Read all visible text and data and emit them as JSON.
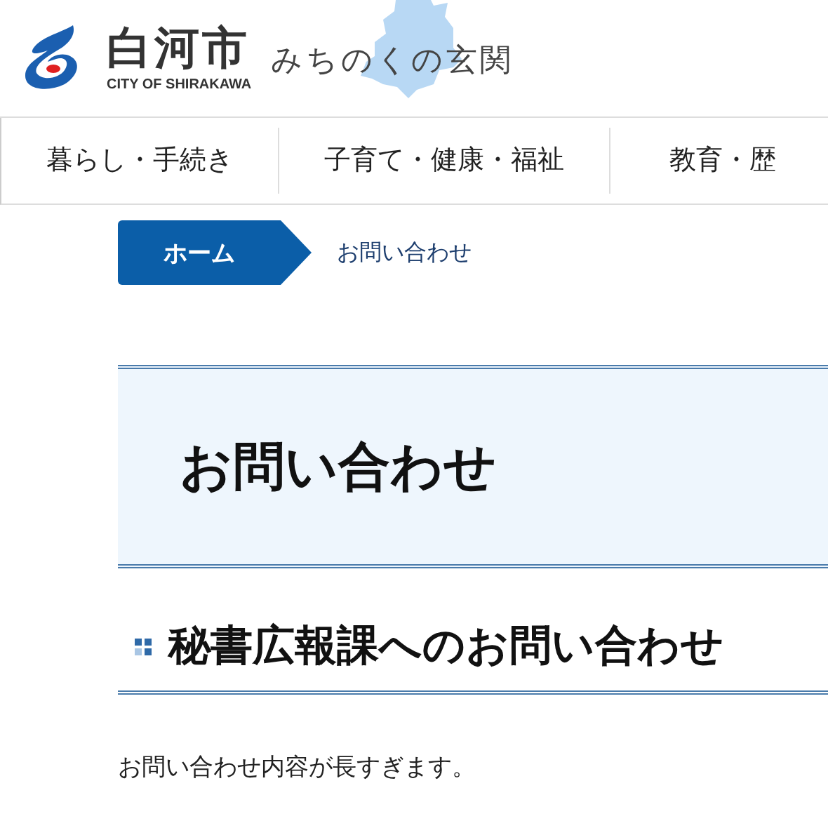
{
  "header": {
    "logo_title": "白河市",
    "logo_subtitle": "CITY OF SHIRAKAWA",
    "tagline": "みちのくの玄関"
  },
  "nav": {
    "items": [
      {
        "label": "暮らし・手続き"
      },
      {
        "label": "子育て・健康・福祉"
      },
      {
        "label": "教育・歴"
      }
    ]
  },
  "breadcrumb": [
    {
      "label": "ホーム",
      "kind": "home"
    },
    {
      "label": "お問い合わせ",
      "kind": "current"
    }
  ],
  "page_title": "お問い合わせ",
  "section_heading": "秘書広報課へのお問い合わせ",
  "message": "お問い合わせ内容が長すぎます。"
}
